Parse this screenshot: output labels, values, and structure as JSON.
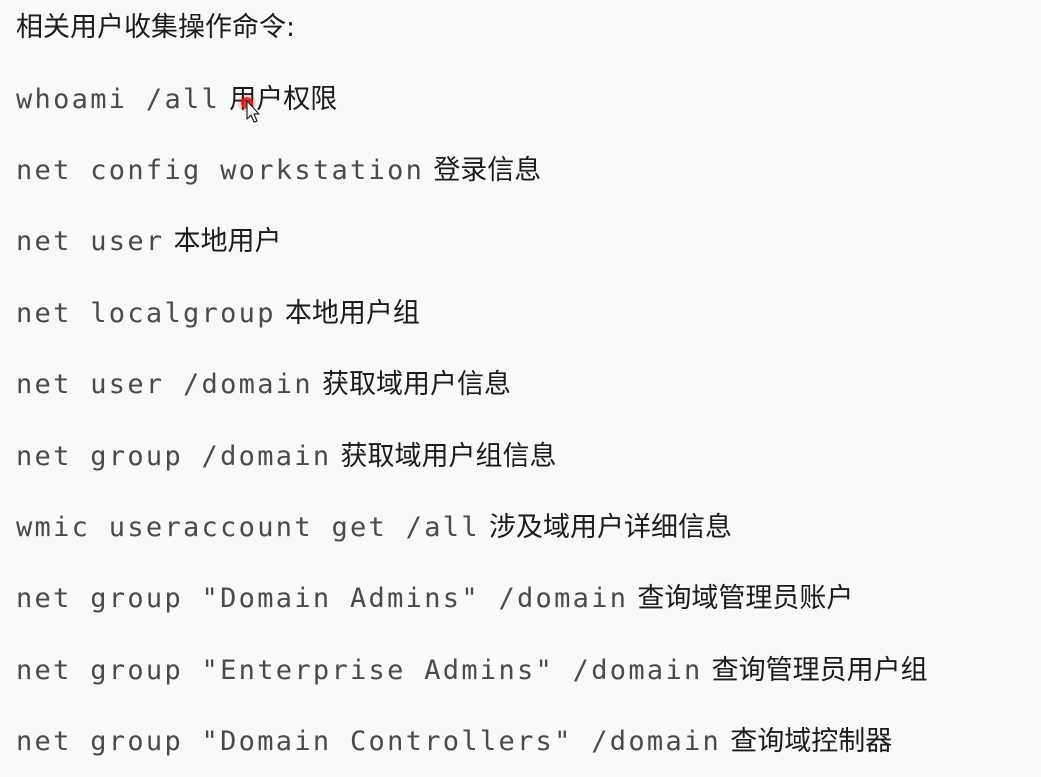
{
  "heading": "相关用户收集操作命令:",
  "commands": [
    {
      "cmd": "whoami /all",
      "desc": "用户权限"
    },
    {
      "cmd": "net config workstation",
      "desc": "登录信息"
    },
    {
      "cmd": "net user",
      "desc": "本地用户"
    },
    {
      "cmd": "net localgroup",
      "desc": "本地用户组"
    },
    {
      "cmd": "net user /domain",
      "desc": "获取域用户信息"
    },
    {
      "cmd": "net group /domain",
      "desc": "获取域用户组信息"
    },
    {
      "cmd": "wmic useraccount get /all",
      "desc": "涉及域用户详细信息"
    },
    {
      "cmd": "net group \"Domain Admins\" /domain",
      "desc": "查询域管理员账户"
    },
    {
      "cmd": "net group \"Enterprise Admins\" /domain",
      "desc": "查询管理员用户组"
    },
    {
      "cmd": "net group \"Domain Controllers\" /domain",
      "desc": "查询域控制器"
    }
  ],
  "colors": {
    "background": "#f9f9f9",
    "command_text": "#4a4a4a",
    "description_text": "#1b1b1b",
    "cursor_highlight": "#e02020"
  },
  "icons": {
    "cursor": "mouse-pointer-icon"
  }
}
